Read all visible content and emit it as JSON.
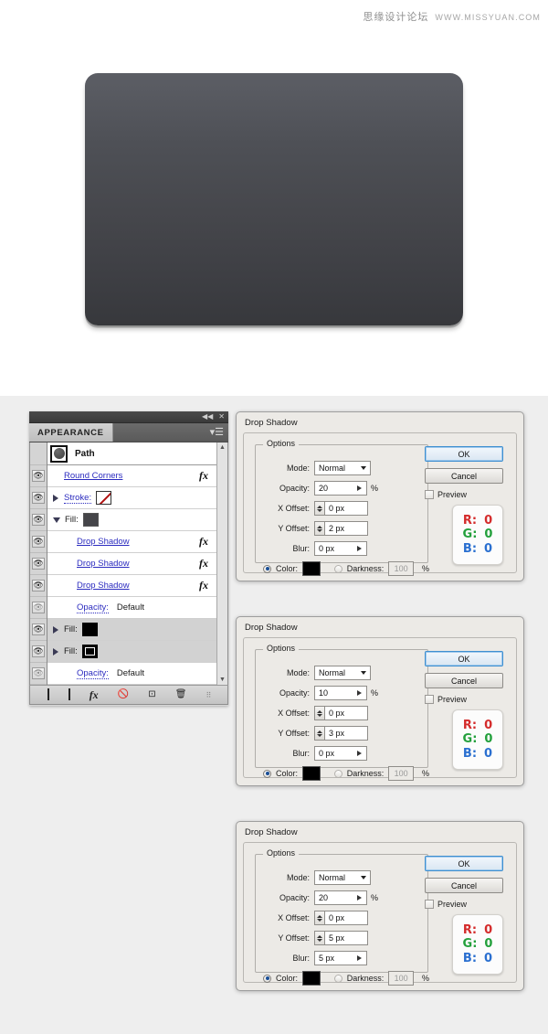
{
  "watermark": {
    "cn": "思缘设计论坛",
    "url": "WWW.MISSYUAN.COM"
  },
  "artboard": {
    "shape_name": "rounded-rectangle"
  },
  "panel": {
    "tab_label": "APPEARANCE",
    "collapse_icon": "◀◀",
    "close_icon": "✕",
    "menu_icon": "▾☰",
    "header": {
      "title": "Path"
    },
    "rows": [
      {
        "label": "Round Corners",
        "style": "link",
        "fx": "fx",
        "indent": false,
        "triangle": "none",
        "swatch": "none-swatch",
        "highlight": false,
        "eye": "on"
      },
      {
        "label": "Stroke:",
        "style": "dotted",
        "fx": "",
        "indent": false,
        "triangle": "right",
        "swatch": "none",
        "highlight": false,
        "eye": "on"
      },
      {
        "label": "Fill:",
        "style": "plain",
        "fx": "",
        "indent": false,
        "triangle": "down",
        "swatch": "dark",
        "highlight": false,
        "eye": "on"
      },
      {
        "label": "Drop Shadow",
        "style": "link",
        "fx": "fx",
        "indent": true,
        "triangle": "spacer",
        "swatch": "",
        "highlight": false,
        "eye": "on"
      },
      {
        "label": "Drop Shadow",
        "style": "link",
        "fx": "fx",
        "indent": true,
        "triangle": "spacer",
        "swatch": "",
        "highlight": false,
        "eye": "on"
      },
      {
        "label": "Drop Shadow",
        "style": "link",
        "fx": "fx",
        "indent": true,
        "triangle": "spacer",
        "swatch": "",
        "highlight": false,
        "eye": "on"
      },
      {
        "label": "Opacity:",
        "style": "dotted",
        "value": "Default",
        "fx": "",
        "indent": true,
        "triangle": "spacer",
        "swatch": "",
        "highlight": false,
        "eye": "dim"
      },
      {
        "label": "Fill:",
        "style": "plain",
        "fx": "",
        "indent": false,
        "triangle": "right",
        "swatch": "black",
        "highlight": true,
        "eye": "on"
      },
      {
        "label": "Fill:",
        "style": "plain",
        "fx": "",
        "indent": false,
        "triangle": "right",
        "swatch": "black-selected",
        "highlight": true,
        "eye": "on"
      },
      {
        "label": "Opacity:",
        "style": "dotted",
        "value": "Default",
        "fx": "",
        "indent": true,
        "triangle": "spacer",
        "swatch": "",
        "highlight": false,
        "eye": "dim"
      }
    ],
    "footer_icons": [
      "add-new-stroke-icon",
      "add-new-fill-icon",
      "add-new-effect-icon",
      "clear-appearance-icon",
      "duplicate-item-icon",
      "delete-item-icon"
    ]
  },
  "dialog_labels": {
    "title": "Drop Shadow",
    "options_legend": "Options",
    "mode": "Mode:",
    "opacity": "Opacity:",
    "x_offset": "X Offset:",
    "y_offset": "Y Offset:",
    "blur": "Blur:",
    "color": "Color:",
    "darkness": "Darkness:",
    "percent": "%",
    "ok": "OK",
    "cancel": "Cancel",
    "preview": "Preview",
    "darkness_value": "100"
  },
  "rgb_readout": {
    "r_label": "R:",
    "r_value": "0",
    "g_label": "G:",
    "g_value": "0",
    "b_label": "B:",
    "b_value": "0"
  },
  "dialogs": [
    {
      "mode": "Normal",
      "opacity": "20",
      "x_offset": "0 px",
      "y_offset": "2 px",
      "blur": "0 px"
    },
    {
      "mode": "Normal",
      "opacity": "10",
      "x_offset": "0 px",
      "y_offset": "3 px",
      "blur": "0 px"
    },
    {
      "mode": "Normal",
      "opacity": "20",
      "x_offset": "0 px",
      "y_offset": "5 px",
      "blur": "5 px"
    }
  ],
  "colors": {
    "link": "#2b2bbf",
    "accent_blue": "#3f8fd0",
    "shape_top": "#5c5e65",
    "shape_bottom": "#37383c",
    "rgb_red": "#d42b2b",
    "rgb_green": "#23a03c",
    "rgb_blue": "#2a6fd0"
  }
}
